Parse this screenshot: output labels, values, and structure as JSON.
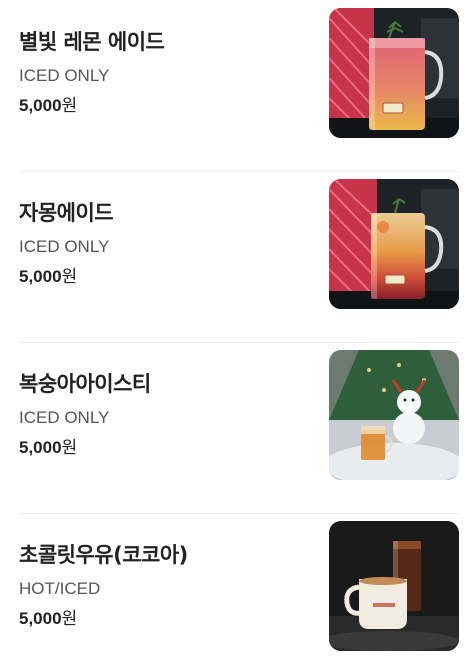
{
  "menu": {
    "items": [
      {
        "name": "별빛 레몬 에이드",
        "option": "ICED ONLY",
        "price": "5,000",
        "currency": "원",
        "image": "pink-lemon-ade-glass"
      },
      {
        "name": "자몽에이드",
        "option": "ICED ONLY",
        "price": "5,000",
        "currency": "원",
        "image": "grapefruit-ade-glass"
      },
      {
        "name": "복숭아아이스티",
        "option": "ICED ONLY",
        "price": "5,000",
        "currency": "원",
        "image": "peach-iced-tea-snowman"
      },
      {
        "name": "초콜릿우유(코코아)",
        "option": "HOT/ICED",
        "price": "5,000",
        "currency": "원",
        "image": "cocoa-mug-and-iced-glass"
      }
    ]
  },
  "colors": {
    "text": "#222222",
    "subtext": "#555555",
    "divider": "#ececec"
  }
}
